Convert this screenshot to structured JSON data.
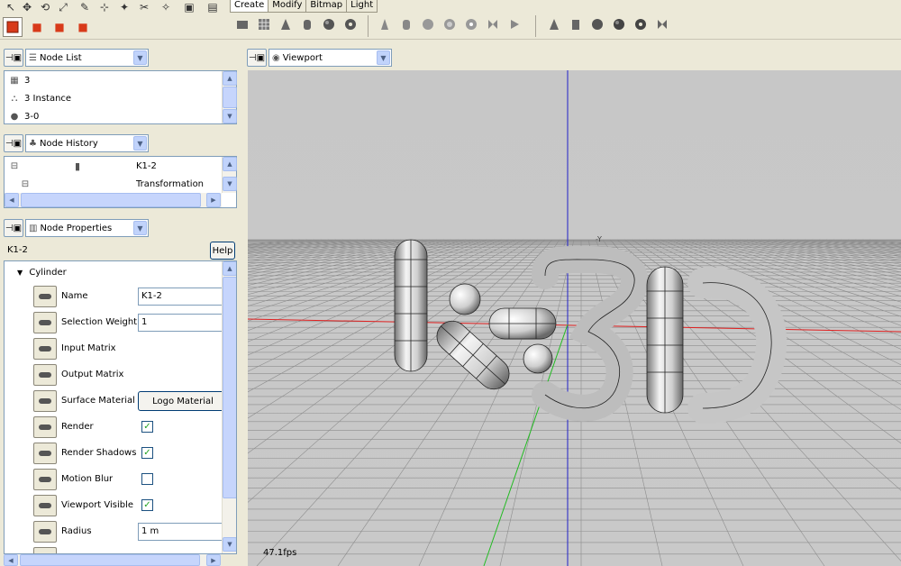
{
  "toolbar": {
    "tabs": [
      "Create",
      "Modify",
      "Bitmap",
      "Light"
    ],
    "active_tab": 0
  },
  "node_list": {
    "combo_label": "Node List",
    "items": [
      {
        "icon": "mesh-icon",
        "label": "3"
      },
      {
        "icon": "instance-icon",
        "label": "3 Instance"
      },
      {
        "icon": "material-icon",
        "label": "3-0"
      }
    ]
  },
  "node_history": {
    "combo_label": "Node History",
    "rows": [
      {
        "name": "K1-2"
      },
      {
        "name": "Transformation"
      }
    ]
  },
  "node_properties": {
    "combo_label": "Node Properties",
    "node_name": "K1-2",
    "help_label": "Help",
    "group_label": "Cylinder",
    "props": [
      {
        "label": "Name",
        "type": "text",
        "value": "K1-2"
      },
      {
        "label": "Selection Weight",
        "type": "text",
        "value": "1"
      },
      {
        "label": "Input Matrix",
        "type": "none"
      },
      {
        "label": "Output Matrix",
        "type": "none"
      },
      {
        "label": "Surface Material",
        "type": "button",
        "value": "Logo Material"
      },
      {
        "label": "Render",
        "type": "check",
        "checked": true
      },
      {
        "label": "Render Shadows",
        "type": "check",
        "checked": true
      },
      {
        "label": "Motion Blur",
        "type": "check",
        "checked": false
      },
      {
        "label": "Viewport Visible",
        "type": "check",
        "checked": true
      },
      {
        "label": "Radius",
        "type": "text",
        "value": "1 m"
      }
    ]
  },
  "viewport": {
    "combo_label": "Viewport",
    "fps": "47.1fps",
    "axis_label": "-Y"
  }
}
